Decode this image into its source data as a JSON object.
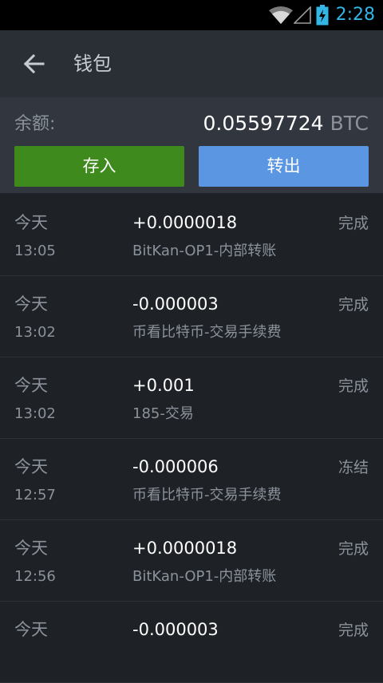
{
  "status_bar": {
    "time": "2:28"
  },
  "app_bar": {
    "back_icon": "arrow-left-icon",
    "title": "钱包"
  },
  "balance": {
    "label": "余额:",
    "amount": "0.05597724",
    "unit": "BTC",
    "deposit_label": "存入",
    "withdraw_label": "转出"
  },
  "colors": {
    "deposit": "#3f8a1c",
    "withdraw": "#5b96e3",
    "status_accent": "#33b5e5"
  },
  "transactions": [
    {
      "day": "今天",
      "time": "13:05",
      "amount": "+0.0000018",
      "desc": "BitKan-OP1-内部转账",
      "status": "完成"
    },
    {
      "day": "今天",
      "time": "13:02",
      "amount": "-0.000003",
      "desc": "币看比特币-交易手续费",
      "status": "完成"
    },
    {
      "day": "今天",
      "time": "13:02",
      "amount": "+0.001",
      "desc": "185-交易",
      "status": "完成"
    },
    {
      "day": "今天",
      "time": "12:57",
      "amount": "-0.000006",
      "desc": "币看比特币-交易手续费",
      "status": "冻结"
    },
    {
      "day": "今天",
      "time": "12:56",
      "amount": "+0.0000018",
      "desc": "BitKan-OP1-内部转账",
      "status": "完成"
    },
    {
      "day": "今天",
      "time": "",
      "amount": "-0.000003",
      "desc": "",
      "status": "完成"
    }
  ]
}
